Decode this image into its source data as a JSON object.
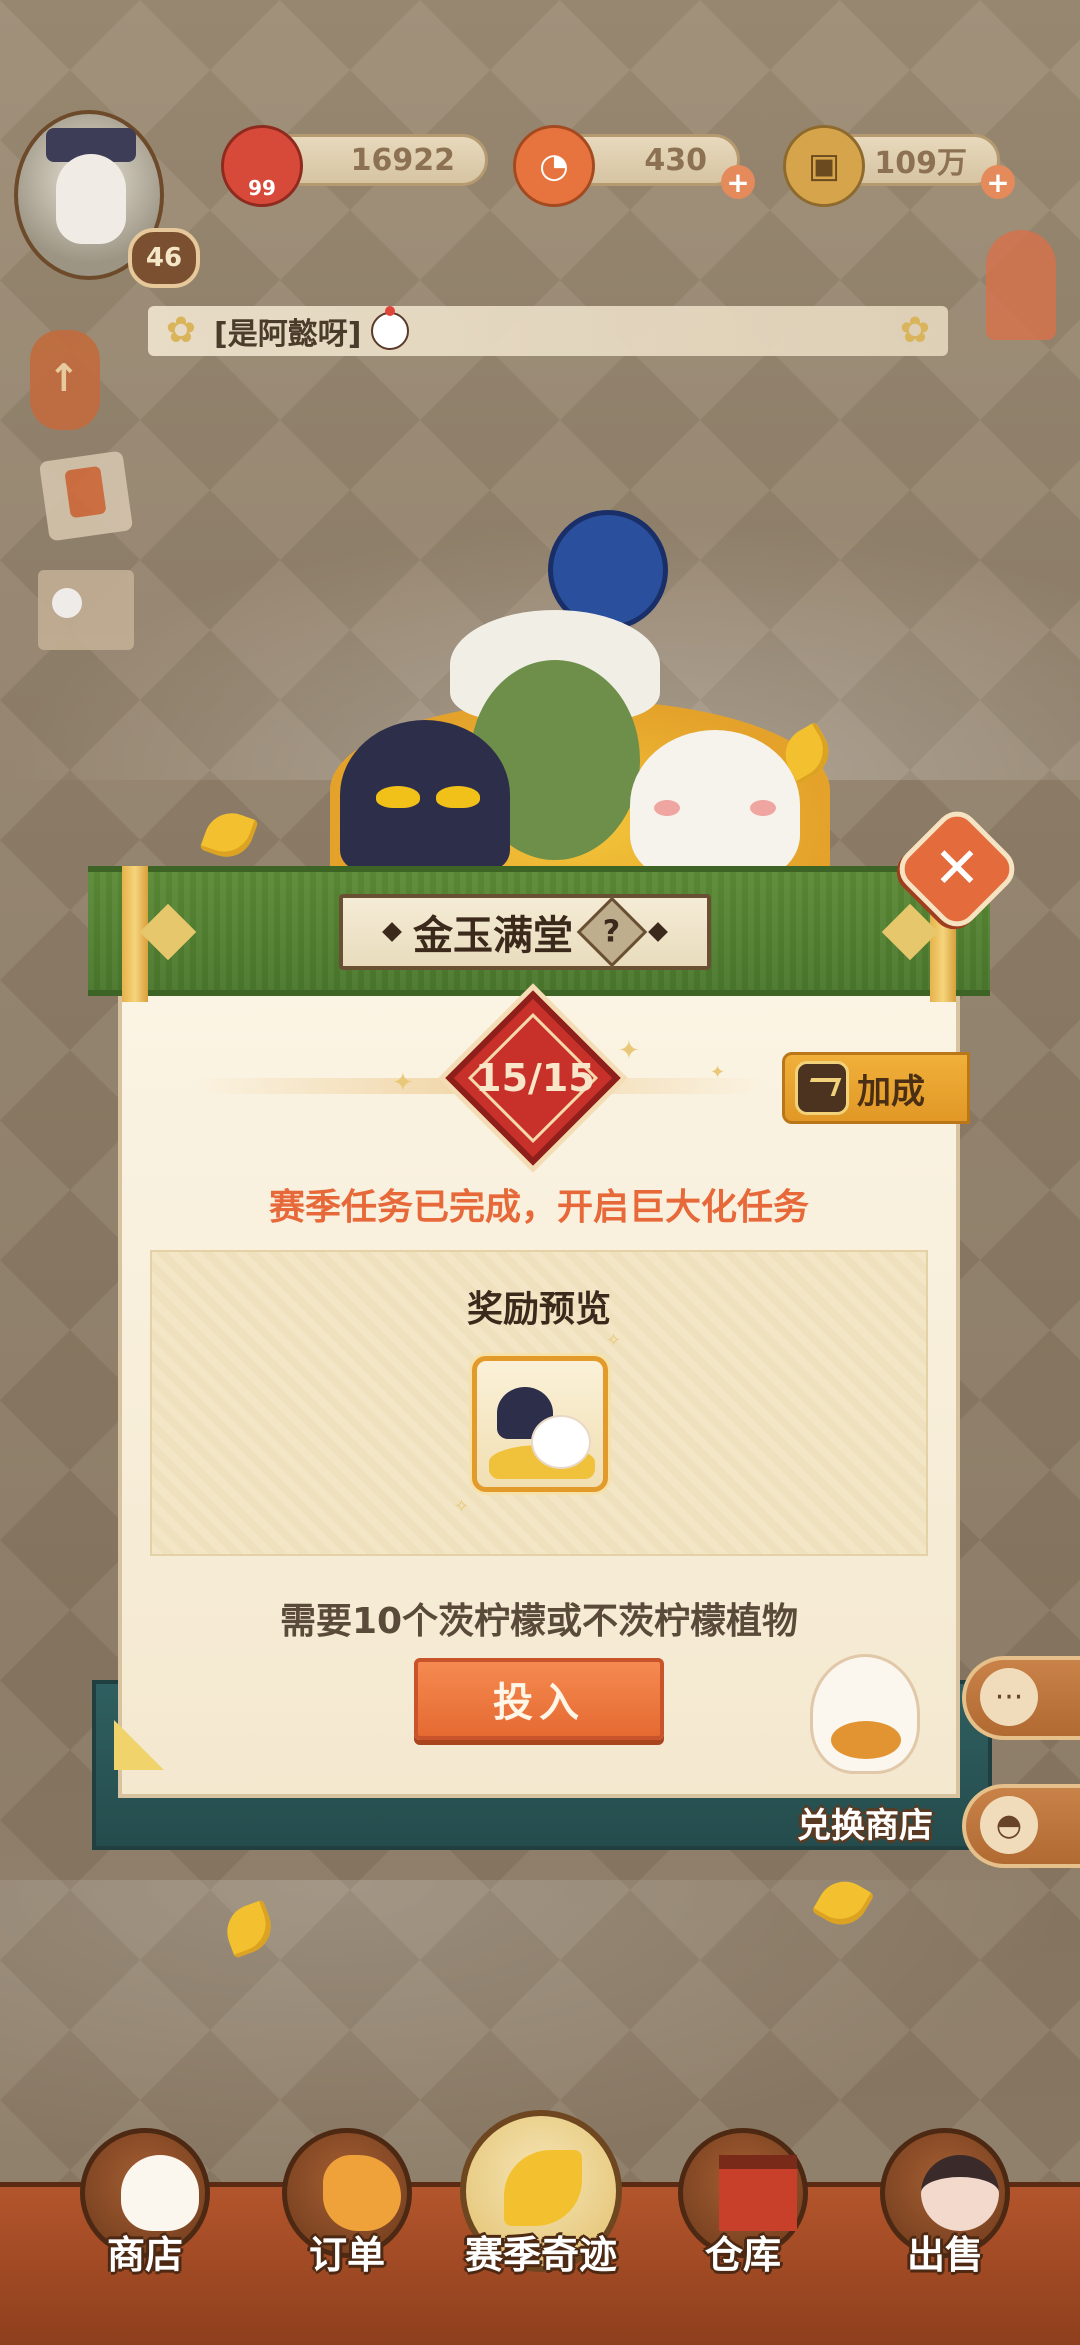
{
  "hud": {
    "player_level": "46",
    "resources": [
      {
        "name": "plum-coin",
        "value": "16922",
        "icon_badge": "99"
      },
      {
        "name": "magatama",
        "value": "430"
      },
      {
        "name": "gold-coin",
        "value": "109万"
      }
    ],
    "player_name": "[是阿懿呀]"
  },
  "dialog": {
    "title": "金玉满堂",
    "help_label": "?",
    "close_label": "✕",
    "progress": "15/15",
    "bonus_label": "加成",
    "status": "赛季任务已完成，开启巨大化任务",
    "reward_title": "奖励预览",
    "requirement": "需要10个茨柠檬或不茨柠檬植物",
    "submit_label": "投入"
  },
  "exchange_shop": {
    "label": "兑换商店"
  },
  "bottom_nav": [
    {
      "label": "商店",
      "icon": "lucky-cat-icon"
    },
    {
      "label": "订单",
      "icon": "bird-icon"
    },
    {
      "label": "赛季奇迹",
      "icon": "ginkgo-icon"
    },
    {
      "label": "仓库",
      "icon": "warehouse-icon"
    },
    {
      "label": "出售",
      "icon": "seller-avatar-icon"
    }
  ],
  "colors": {
    "accent_orange": "#e7693a",
    "header_green": "#5b8a35",
    "badge_red": "#c8302a",
    "gold": "#f0b03a"
  }
}
